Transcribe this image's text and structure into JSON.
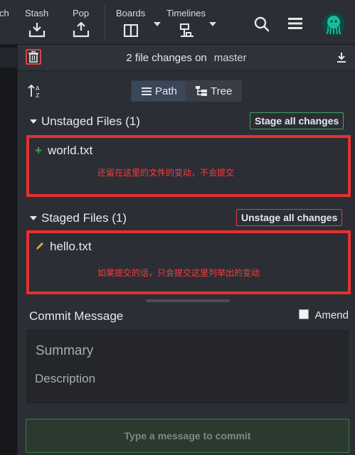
{
  "toolbar": {
    "partial_label": "ch",
    "stash_label": "Stash",
    "pop_label": "Pop",
    "boards_label": "Boards",
    "timelines_label": "Timelines",
    "icons": [
      "stash-icon",
      "pop-icon",
      "boards-icon",
      "timelines-icon",
      "search-icon",
      "menu-icon",
      "gitkraken-logo"
    ]
  },
  "panel": {
    "changes_summary": "2 file changes on",
    "branch": "master",
    "view_toggle": {
      "path_label": "Path",
      "tree_label": "Tree",
      "active": "Path"
    },
    "unstaged": {
      "title": "Unstaged Files (1)",
      "action": "Stage all changes",
      "files": [
        {
          "name": "world.txt",
          "status": "added"
        }
      ],
      "annotation": "还留在这里的文件的变动，不会提交"
    },
    "staged": {
      "title": "Staged Files (1)",
      "action": "Unstage all changes",
      "files": [
        {
          "name": "hello.txt",
          "status": "modified"
        }
      ],
      "annotation": "如果提交的话，只会提交这里列举出的变动"
    },
    "commit": {
      "label": "Commit Message",
      "amend_label": "Amend",
      "amend_checked": false,
      "summary_placeholder": "Summary",
      "description_placeholder": "Description",
      "button_label": "Type a message to commit"
    }
  },
  "colors": {
    "accent_green": "#3fa45a",
    "annotation_red": "#e63030",
    "modified_orange": "#e8a33c",
    "logo_teal": "#1abc9c"
  }
}
